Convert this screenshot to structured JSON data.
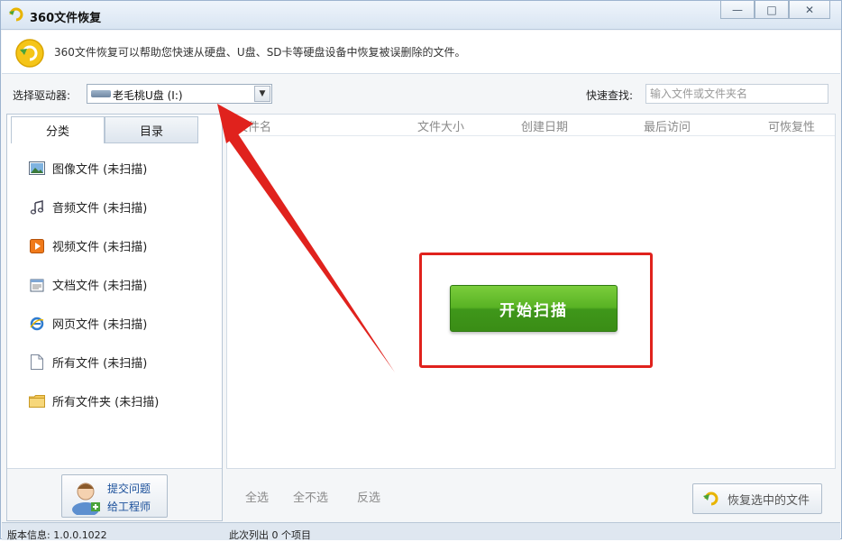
{
  "window": {
    "title": "360文件恢复",
    "minimize_glyph": "—",
    "maximize_glyph": "□",
    "close_glyph": "✕"
  },
  "info": {
    "text": "360文件恢复可以帮助您快速从硬盘、U盘、SD卡等硬盘设备中恢复被误删除的文件。"
  },
  "toolbar": {
    "drive_label": "选择驱动器:",
    "drive_value": "老毛桃U盘 (I:)",
    "search_label": "快速查找:",
    "search_placeholder": "输入文件或文件夹名"
  },
  "sidebar": {
    "tabs": [
      {
        "label": "分类",
        "active": true
      },
      {
        "label": "目录",
        "active": false
      }
    ],
    "categories": [
      {
        "label": "图像文件 (未扫描)",
        "icon": "image-icon"
      },
      {
        "label": "音频文件 (未扫描)",
        "icon": "music-icon"
      },
      {
        "label": "视频文件 (未扫描)",
        "icon": "video-icon"
      },
      {
        "label": "文档文件 (未扫描)",
        "icon": "document-icon"
      },
      {
        "label": "网页文件 (未扫描)",
        "icon": "ie-icon"
      },
      {
        "label": "所有文件 (未扫描)",
        "icon": "file-icon"
      },
      {
        "label": "所有文件夹 (未扫描)",
        "icon": "folder-icon"
      }
    ],
    "support": {
      "line1": "提交问题",
      "line2": "给工程师"
    }
  },
  "table": {
    "columns": [
      "文件名",
      "文件大小",
      "创建日期",
      "最后访问",
      "可恢复性"
    ]
  },
  "main": {
    "start_button": "开始扫描"
  },
  "actions": {
    "select_all": "全选",
    "select_none": "全不选",
    "invert": "反选",
    "restore": "恢复选中的文件"
  },
  "status": {
    "version": "版本信息: 1.0.0.1022",
    "count": "此次列出 0 个项目"
  },
  "colors": {
    "accent_green": "#58b224",
    "annotation_red": "#e0221d",
    "link_blue": "#1a4f9a"
  }
}
